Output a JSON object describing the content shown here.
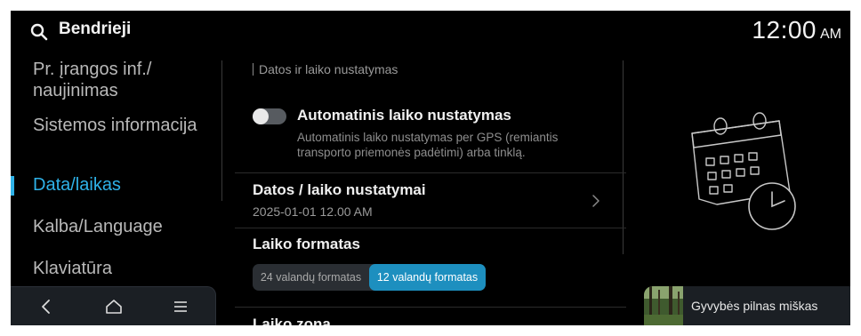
{
  "header": {
    "title": "Bendrieji",
    "time": "12:00",
    "ampm": "AM"
  },
  "sidebar": {
    "items": [
      {
        "label": "Pr. įrangos inf./ naujinimas"
      },
      {
        "label": "Sistemos informacija"
      },
      {
        "label": "Data/laikas",
        "active": true
      },
      {
        "label": "Kalba/Language"
      },
      {
        "label": "Klaviatūra"
      }
    ]
  },
  "content": {
    "section_label": "Datos ir laiko nustatymas",
    "auto_time": {
      "title": "Automatinis laiko nustatymas",
      "description": "Automatinis laiko nustatymas per GPS (remiantis transporto priemonės padėtimi) arba tinklą.",
      "enabled": false
    },
    "datetime_settings": {
      "title": "Datos / laiko nustatymai",
      "value": "2025-01-01 12.00 AM"
    },
    "time_format": {
      "title": "Laiko formatas",
      "options": [
        "24 valandų formatas",
        "12 valandų formatas"
      ],
      "selected": "12 valandų formatas"
    },
    "time_zone": {
      "title": "Laiko zona"
    }
  },
  "media": {
    "title": "Gyvybės pilnas miškas"
  },
  "colors": {
    "accent": "#2fb2e8",
    "selected_segment": "#1d8fbf",
    "background": "#000000"
  },
  "icons": [
    "search-icon",
    "back-icon",
    "home-icon",
    "menu-icon",
    "chevron-right-icon",
    "calendar-clock-illustration"
  ]
}
